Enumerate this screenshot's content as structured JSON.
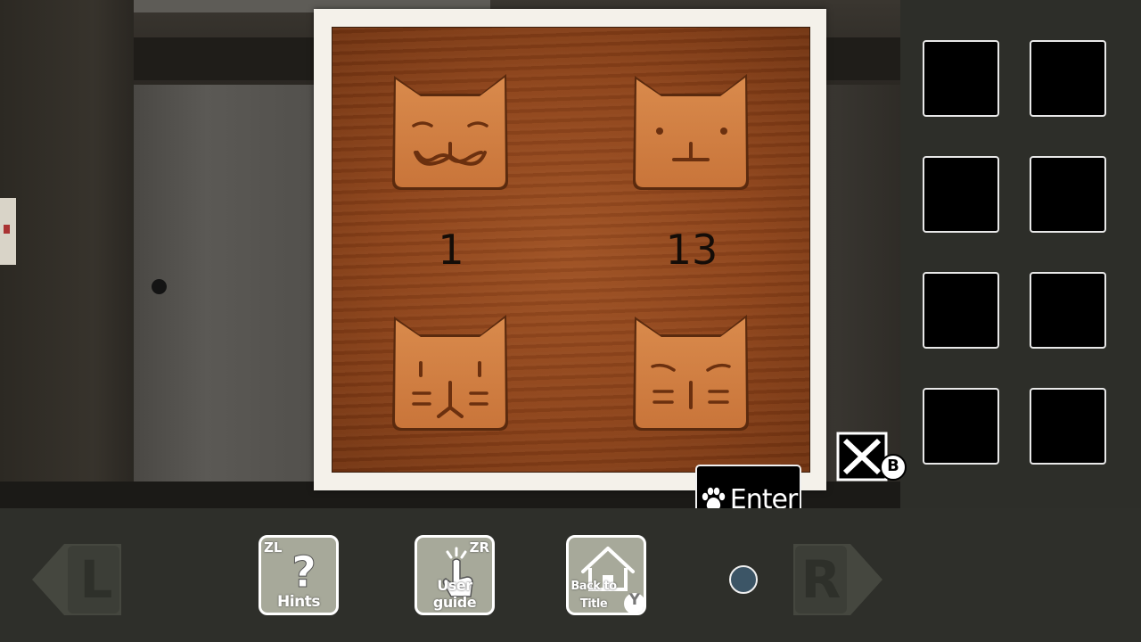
{
  "puzzle": {
    "numbers": [
      "1",
      "13"
    ],
    "cats": [
      "smiling-cat-icon",
      "plain-cat-icon",
      "whisker-cat-icon",
      "sleepy-whisker-cat-icon"
    ]
  },
  "enter_button": {
    "label": "Enter",
    "icon": "paw-icon"
  },
  "close_button": {
    "badge": "B",
    "icon": "close-icon"
  },
  "inventory": {
    "slots": 8
  },
  "toolbar": {
    "hints": {
      "label": "Hints",
      "badge": "ZL"
    },
    "user_guide": {
      "label": "User guide",
      "badge": "ZR"
    },
    "back_to_title": {
      "label_line1": "Back to",
      "label_line2": "Title",
      "badge": "Y"
    },
    "left_nav": {
      "label": "L"
    },
    "right_nav": {
      "label": "R"
    }
  },
  "colors": {
    "board_wood": "#8a4119",
    "frame": "#f4f1ea",
    "tool_button": "#a7a99a",
    "indicator_dot": "#3c5566"
  }
}
